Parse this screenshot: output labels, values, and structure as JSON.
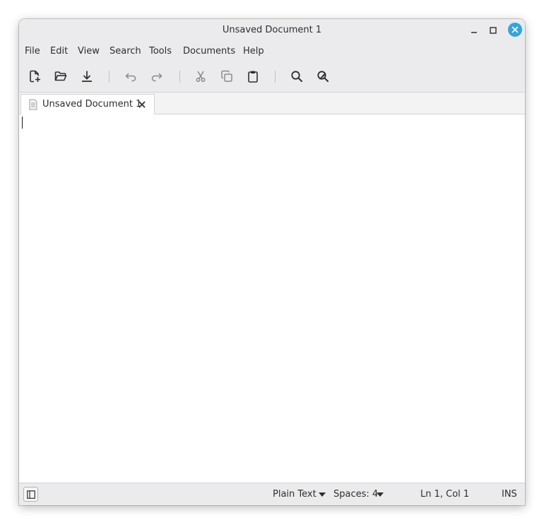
{
  "window": {
    "title": "Unsaved Document 1",
    "accent_color": "#35a4e0"
  },
  "menu": [
    {
      "label": "File"
    },
    {
      "label": "Edit"
    },
    {
      "label": "View"
    },
    {
      "label": "Search"
    },
    {
      "label": "Tools"
    },
    {
      "label": "Documents"
    },
    {
      "label": "Help"
    }
  ],
  "toolbar": {
    "buttons": [
      "new-document-icon",
      "open-folder-icon",
      "save-download-icon",
      "undo-icon",
      "redo-icon",
      "cut-icon",
      "copy-icon",
      "paste-icon",
      "search-icon",
      "find-replace-icon"
    ]
  },
  "tabs": [
    {
      "label": "Unsaved Document 1"
    }
  ],
  "editor": {
    "content": ""
  },
  "statusbar": {
    "language": "Plain Text",
    "indent": "Spaces: 4",
    "position": "Ln 1, Col 1",
    "mode": "INS"
  }
}
